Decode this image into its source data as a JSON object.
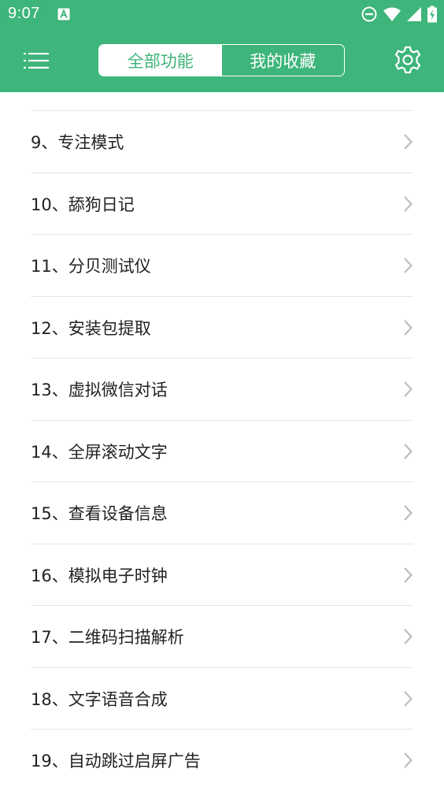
{
  "status_bar": {
    "time": "9:07",
    "icons": [
      "notification-a-icon",
      "do-not-disturb-icon",
      "wifi-icon",
      "signal-icon",
      "battery-charging-icon"
    ]
  },
  "app_bar": {
    "menu_icon": "menu-list-icon",
    "tabs": [
      {
        "label": "全部功能",
        "selected": true
      },
      {
        "label": "我的收藏",
        "selected": false
      }
    ],
    "settings_icon": "gear-icon"
  },
  "colors": {
    "primary": "#3eb57a",
    "on_primary": "#ffffff",
    "text": "#222222",
    "divider": "#e6e6e6",
    "chevron": "#bdbdbd"
  },
  "list": {
    "items": [
      {
        "label": "9、专注模式"
      },
      {
        "label": "10、舔狗日记"
      },
      {
        "label": "11、分贝测试仪"
      },
      {
        "label": "12、安装包提取"
      },
      {
        "label": "13、虚拟微信对话"
      },
      {
        "label": "14、全屏滚动文字"
      },
      {
        "label": "15、查看设备信息"
      },
      {
        "label": "16、模拟电子时钟"
      },
      {
        "label": "17、二维码扫描解析"
      },
      {
        "label": "18、文字语音合成"
      },
      {
        "label": "19、自动跳过启屏广告"
      }
    ]
  }
}
